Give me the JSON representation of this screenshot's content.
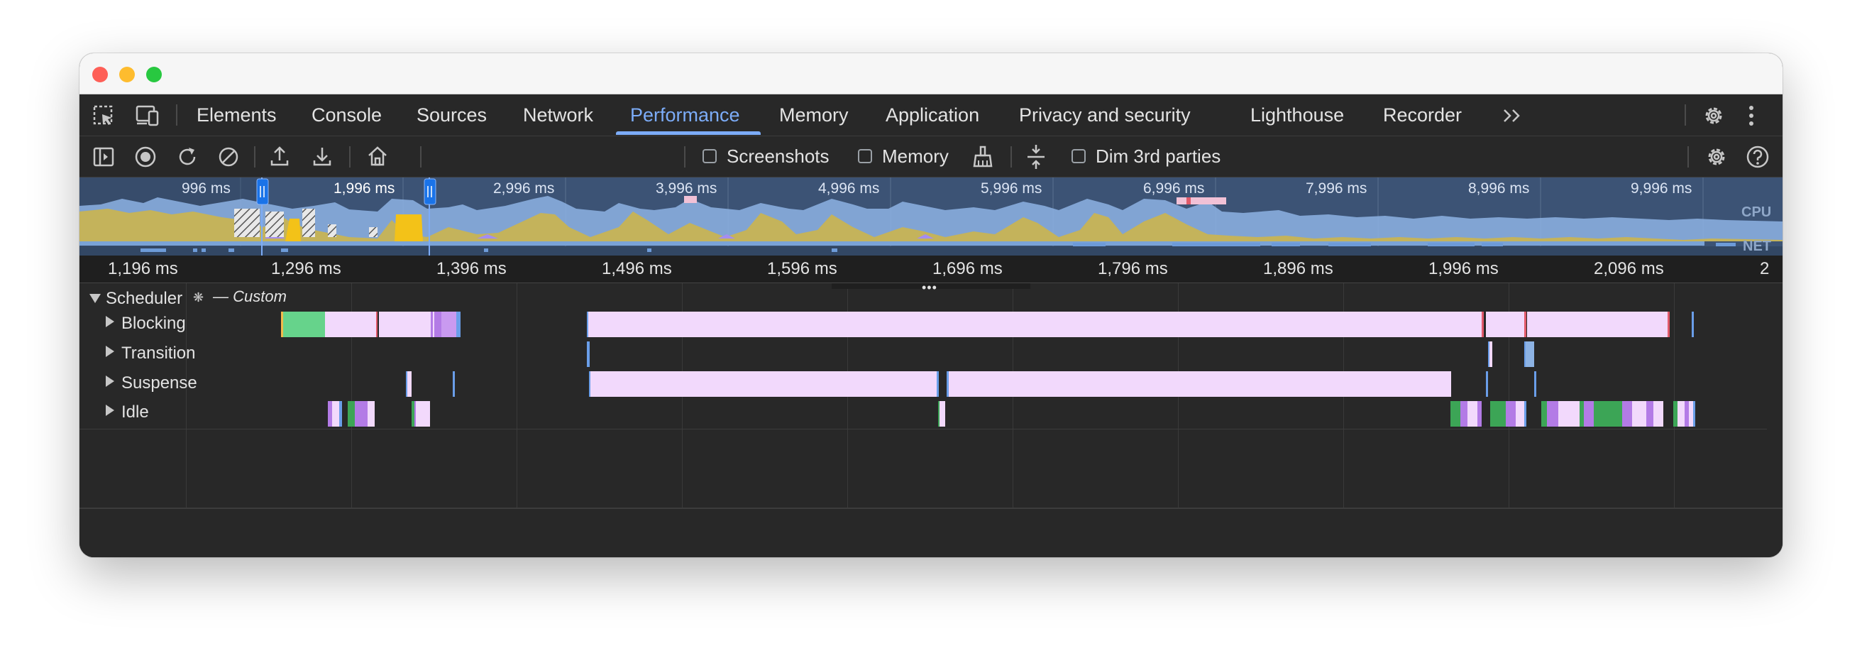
{
  "tabs": {
    "elements": "Elements",
    "console": "Console",
    "sources": "Sources",
    "network": "Network",
    "performance": "Performance",
    "memory": "Memory",
    "application": "Application",
    "privacy": "Privacy and security",
    "lighthouse": "Lighthouse",
    "recorder": "Recorder",
    "more": ">>",
    "active": "Performance"
  },
  "toolbar": {
    "screenshots": "Screenshots",
    "memory": "Memory",
    "dim_3rd_parties": "Dim 3rd parties",
    "screenshots_checked": false,
    "memory_checked": false,
    "dim_checked": false
  },
  "overview": {
    "ticks": [
      "996 ms",
      "1,996 ms",
      "2,996 ms",
      "3,996 ms",
      "4,996 ms",
      "5,996 ms",
      "6,996 ms",
      "7,996 ms",
      "8,996 ms",
      "9,996 ms"
    ],
    "cpu_label": "CPU",
    "net_label": "NET"
  },
  "ruler": {
    "ticks": [
      "1,196 ms",
      "1,296 ms",
      "1,396 ms",
      "1,496 ms",
      "1,596 ms",
      "1,696 ms",
      "1,796 ms",
      "1,896 ms",
      "1,996 ms",
      "2,096 ms",
      "2"
    ]
  },
  "tracks": {
    "group": "Scheduler",
    "group_suffix": "— Custom",
    "rows": [
      "Blocking",
      "Transition",
      "Suspense",
      "Idle"
    ]
  },
  "colors": {
    "accent": "#7cacf8",
    "overview_bg": "#3c5375",
    "scripting": "#c4b35b",
    "render": "#a58df0",
    "cpu_blue": "#8db3e4",
    "track_pink": "#f2d9fc",
    "track_green": "#66d38b",
    "track_purple": "#b37be6",
    "track_blue": "#6a9ee9"
  }
}
